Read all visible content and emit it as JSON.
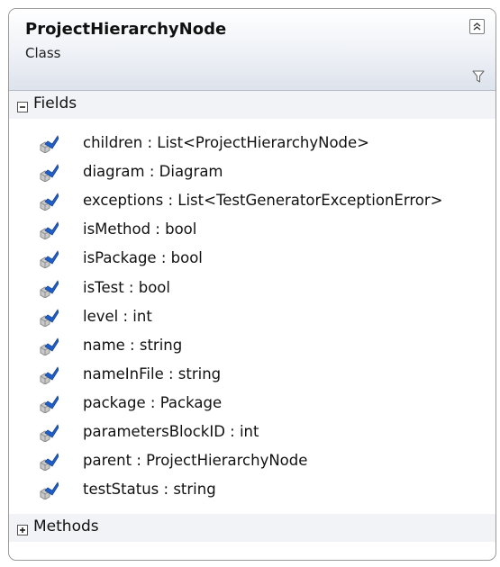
{
  "class": {
    "name": "ProjectHierarchyNode",
    "kind": "Class"
  },
  "icons": {
    "collapse": "double-chevron-up-icon",
    "filter": "filter-icon",
    "field": "field-icon",
    "section_expanded": "minus-box-icon",
    "section_collapsed": "plus-box-icon"
  },
  "colors": {
    "field_icon_blue": "#1f5fc9",
    "field_icon_gray": "#8a8a8a",
    "border": "#9a9a9a"
  },
  "sections": {
    "fields": {
      "label": "Fields",
      "expanded": true,
      "items": [
        "children : List<ProjectHierarchyNode>",
        "diagram : Diagram",
        "exceptions : List<TestGeneratorExceptionError>",
        "isMethod : bool",
        "isPackage : bool",
        "isTest : bool",
        "level : int",
        "name : string",
        "nameInFile : string",
        "package : Package",
        "parametersBlockID : int",
        "parent : ProjectHierarchyNode",
        "testStatus : string"
      ]
    },
    "methods": {
      "label": "Methods",
      "expanded": false
    }
  }
}
